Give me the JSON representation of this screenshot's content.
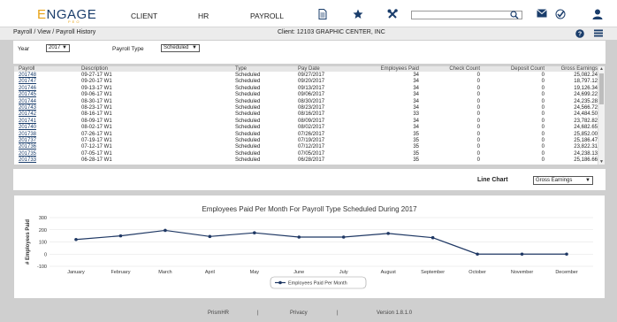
{
  "nav": {
    "logo_first": "E",
    "logo_rest": "NGAGE",
    "logo_sub": "PEO",
    "items": [
      "CLIENT",
      "HR",
      "PAYROLL"
    ],
    "search_value": ""
  },
  "subheader": {
    "breadcrumb": "Payroll / View / Payroll History",
    "client": "Client:  12103 GRAPHIC CENTER, INC"
  },
  "filters": {
    "year_label": "Year",
    "year_value": "2017",
    "type_label": "Payroll Type",
    "type_value": "Scheduled"
  },
  "table": {
    "headers": [
      "Payroll",
      "Description",
      "Type",
      "Pay Date",
      "Employees Paid",
      "Check Count",
      "Deposit Count",
      "Gross Earnings"
    ],
    "rows": [
      [
        "201748",
        "09-27-17 W1",
        "Scheduled",
        "09/27/2017",
        "34",
        "0",
        "0",
        "25,082.24"
      ],
      [
        "201747",
        "09-20-17 W1",
        "Scheduled",
        "09/20/2017",
        "34",
        "0",
        "0",
        "18,797.12"
      ],
      [
        "201746",
        "09-13-17 W1",
        "Scheduled",
        "09/13/2017",
        "34",
        "0",
        "0",
        "19,126.34"
      ],
      [
        "201745",
        "09-06-17 W1",
        "Scheduled",
        "09/06/2017",
        "34",
        "0",
        "0",
        "24,699.22"
      ],
      [
        "201744",
        "08-30-17 W1",
        "Scheduled",
        "08/30/2017",
        "34",
        "0",
        "0",
        "24,235.28"
      ],
      [
        "201743",
        "08-23-17 W1",
        "Scheduled",
        "08/23/2017",
        "34",
        "0",
        "0",
        "24,566.72"
      ],
      [
        "201742",
        "08-16-17 W1",
        "Scheduled",
        "08/16/2017",
        "33",
        "0",
        "0",
        "24,484.50"
      ],
      [
        "201741",
        "08-09-17 W1",
        "Scheduled",
        "08/09/2017",
        "34",
        "0",
        "0",
        "23,782.82"
      ],
      [
        "201740",
        "08-02-17 W1",
        "Scheduled",
        "08/02/2017",
        "34",
        "0",
        "0",
        "24,682.65"
      ],
      [
        "201738",
        "07-26-17 W1",
        "Scheduled",
        "07/26/2017",
        "35",
        "0",
        "0",
        "25,852.00"
      ],
      [
        "201737",
        "07-19-17 W1",
        "Scheduled",
        "07/19/2017",
        "35",
        "0",
        "0",
        "25,186.47"
      ],
      [
        "201736",
        "07-12-17 W1",
        "Scheduled",
        "07/12/2017",
        "35",
        "0",
        "0",
        "23,822.31"
      ],
      [
        "201735",
        "07-05-17 W1",
        "Scheduled",
        "07/05/2017",
        "35",
        "0",
        "0",
        "24,238.13"
      ],
      [
        "201733",
        "06-28-17 W1",
        "Scheduled",
        "06/28/2017",
        "35",
        "0",
        "0",
        "25,186.66"
      ]
    ]
  },
  "selector": {
    "label": "Line Chart",
    "value": "Gross Earnings"
  },
  "chart_data": {
    "type": "line",
    "title": "Employees Paid Per Month For Payroll Type Scheduled During 2017",
    "ylabel": "# Employees Paid",
    "xlabel": "",
    "categories": [
      "January",
      "February",
      "March",
      "April",
      "May",
      "June",
      "July",
      "August",
      "September",
      "October",
      "November",
      "December"
    ],
    "series": [
      {
        "name": "Employees Paid Per Month",
        "values": [
          120,
          150,
          195,
          145,
          175,
          140,
          140,
          170,
          135,
          0,
          0,
          0
        ]
      }
    ],
    "ylim": [
      -100,
      300
    ],
    "yticks": [
      -100,
      0,
      100,
      200,
      300
    ],
    "grid": true,
    "legend": "bottom",
    "color": "#1f3864"
  },
  "footer": {
    "left": "PrismHR",
    "sep1": "|",
    "middle": "Privacy",
    "sep2": "|",
    "right": "Version 1.8.1.0"
  },
  "colors": {
    "brand": "#1a3d6b",
    "accent": "#e8a317"
  }
}
